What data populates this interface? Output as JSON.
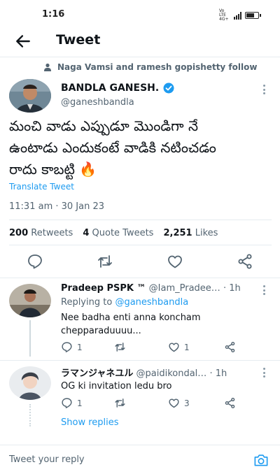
{
  "status_bar": {
    "time": "1:16",
    "network_label": "Vo LTE 4G+",
    "battery_level": 0.7
  },
  "header": {
    "back_icon": "back-arrow-icon",
    "title": "Tweet"
  },
  "social_context": {
    "icon": "person-icon",
    "text": "Naga Vamsi and ramesh gopishetty follow"
  },
  "tweet": {
    "author_name": "BANDLA GANESH.",
    "verified": true,
    "handle": "@ganeshbandla",
    "text": "మంచి వాడు ఎప్పుడూ మొండిగా నే\nఉంటాడు ఎందుకంటే వాడికి నటించడం\nరాదు కాబట్టి 🔥",
    "translate_label": "Translate Tweet",
    "timestamp": "11:31 am · 30 Jan 23",
    "stats": {
      "retweets_count": "200",
      "retweets_label": "Retweets",
      "quotes_count": "4",
      "quotes_label": "Quote Tweets",
      "likes_count": "2,251",
      "likes_label": "Likes"
    },
    "actions": [
      "reply-icon",
      "retweet-icon",
      "like-icon",
      "share-icon"
    ]
  },
  "replies": [
    {
      "name": "Pradeep PSPK ™",
      "handle": "@Iam_Pradee…",
      "time": "· 1h",
      "replying_prefix": "Replying to",
      "replying_to": "@ganeshbandla",
      "text": "Nee badha enti anna koncham\nchepparaduuuu...",
      "reply_count": "1",
      "retweet_count": "",
      "like_count": "1"
    },
    {
      "name": "ラマンジャネユル",
      "handle": "@paidikondal…",
      "time": "· 1h",
      "text": "OG ki invitation ledu bro",
      "reply_count": "1",
      "retweet_count": "",
      "like_count": "3"
    }
  ],
  "show_replies_label": "Show replies",
  "reply_bar": {
    "placeholder": "Tweet your reply",
    "camera_icon": "camera-icon"
  },
  "colors": {
    "accent": "#1d9bf0",
    "secondary_text": "#536471",
    "divider": "#e6ecf0"
  }
}
